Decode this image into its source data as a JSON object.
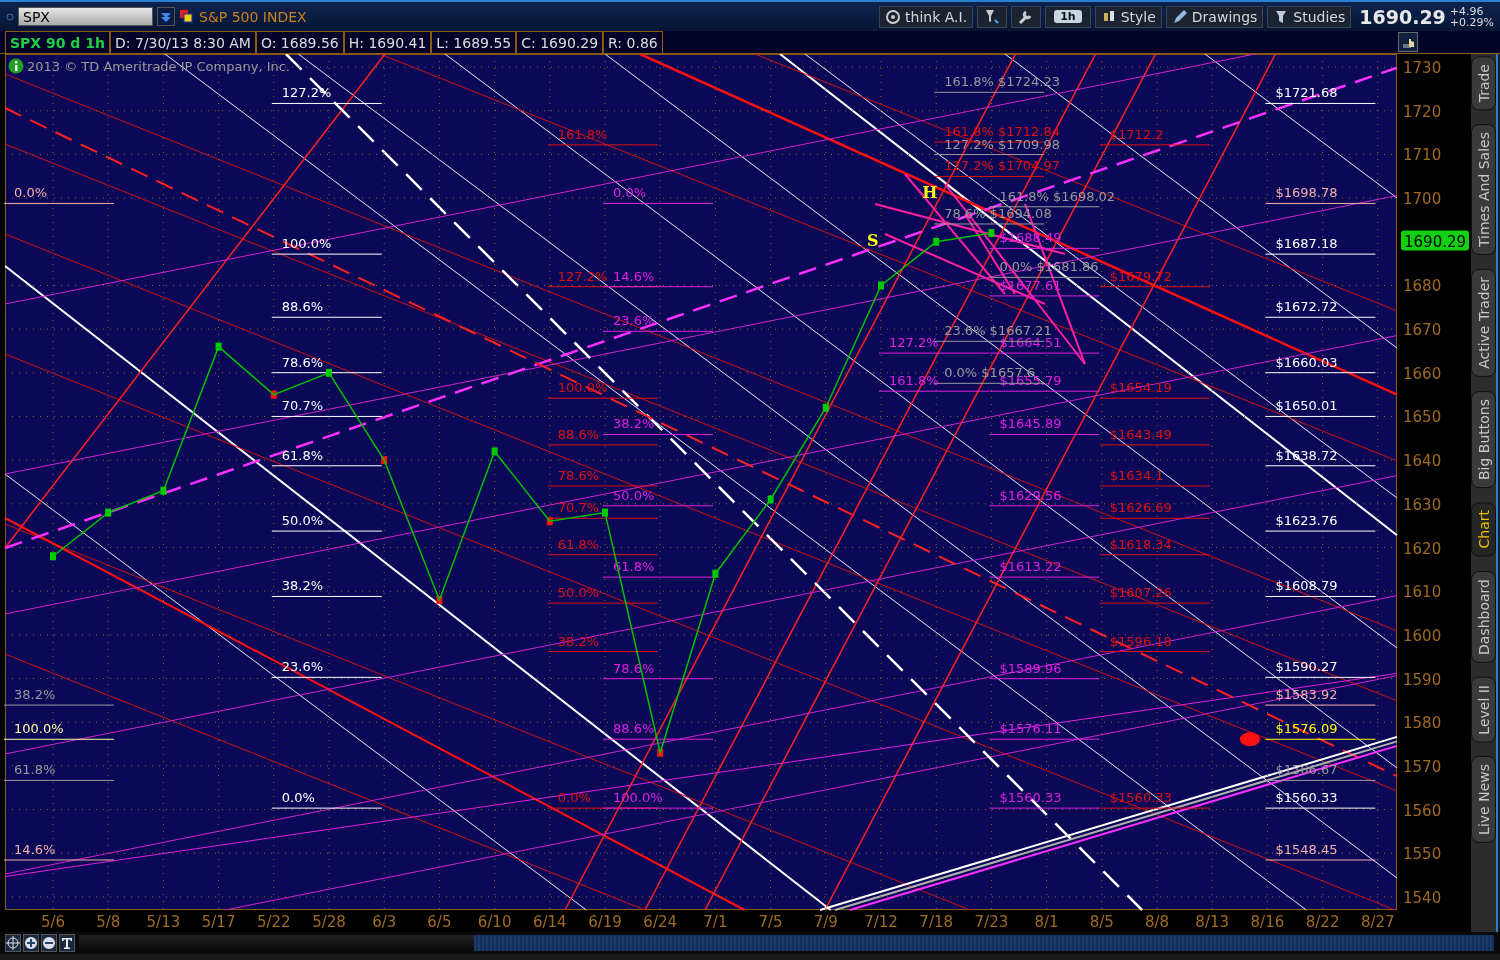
{
  "symbol_bar": {
    "symbol": "SPX",
    "description": "S&P 500 INDEX"
  },
  "toolbar": [
    {
      "kind": "ai",
      "label": "think A.I."
    },
    {
      "kind": "timeframe",
      "label": "1h"
    },
    {
      "kind": "style",
      "label": "Style"
    },
    {
      "kind": "drawings",
      "label": "Drawings"
    },
    {
      "kind": "studies",
      "label": "Studies"
    }
  ],
  "quote": {
    "last": "1690.29",
    "change": "+4.96",
    "change_pct": "+0.29%"
  },
  "info_strip": [
    "SPX 90 d 1h",
    "D: 7/30/13 8:30 AM",
    "O: 1689.56",
    "H: 1690.41",
    "L: 1689.55",
    "C: 1690.29",
    "R: 0.86"
  ],
  "copyright": "2013 © TD Ameritrade IP Company, Inc.",
  "chart": {
    "last_price_marker": "1690.29",
    "chart_data": {
      "type": "line",
      "grid": true,
      "categories": [
        "5/6",
        "5/8",
        "5/13",
        "5/17",
        "5/22",
        "5/28",
        "6/3",
        "6/5",
        "6/10",
        "6/14",
        "6/19",
        "6/24",
        "7/1",
        "7/5",
        "7/9",
        "7/12",
        "7/18",
        "7/23",
        "8/1",
        "8/5",
        "8/8",
        "8/13",
        "8/16",
        "8/22",
        "8/27"
      ],
      "series": [
        {
          "color": "#00c000",
          "marker": true,
          "values": [
            1618,
            1628,
            1633,
            1666,
            1655,
            1660,
            1640,
            1608,
            1642,
            1626,
            1628,
            1573,
            1614,
            1631,
            1652,
            1680,
            1690,
            1692,
            null,
            null,
            null,
            null,
            null,
            null,
            null
          ]
        }
      ],
      "ylim": [
        1537,
        1733
      ],
      "yticks": [
        1540,
        1550,
        1560,
        1570,
        1580,
        1590,
        1600,
        1610,
        1620,
        1630,
        1640,
        1650,
        1660,
        1670,
        1680,
        1700,
        1710,
        1720,
        1730
      ],
      "annotations": [
        "S",
        "H",
        "161.8% $1724.23",
        "$1721.68",
        "$1698.78",
        "$1687.18",
        "$1672.72",
        "$1660.03",
        "$1650.01",
        "$1638.72",
        "$1623.76",
        "$1608.79",
        "$1590.27",
        "$1583.92",
        "$1576.09",
        "$1566.67",
        "$1560.33",
        "$1548.45",
        "$1712.2",
        "$1679.72",
        "$1654.19",
        "$1643.49",
        "$1634.1",
        "$1626.69",
        "$1618.34",
        "$1607.26",
        "$1596.18",
        "$1560.33",
        "$1688.49",
        "$1677.61",
        "$1664.51",
        "$1655.79",
        "$1645.89",
        "$1629.56",
        "$1613.22",
        "$1589.96",
        "$1576.11",
        "$1560.33",
        "161.8% $1712.84",
        "127.2% $1709.98",
        "127.2% $1704.97",
        "161.8% $1698.02",
        "78.6% $1694.08",
        "0.0% $1681.86",
        "23.6% $1667.21",
        "0.0% $1657.6",
        "127.2%",
        "161.8%",
        "127.2%",
        "100.0%",
        "88.6%",
        "78.6%",
        "70.7%",
        "61.8%",
        "50.0%",
        "38.2%",
        "23.6%",
        "0.0%",
        "0.0%",
        "38.2%",
        "100.0%",
        "61.8%",
        "14.6%",
        "161.8%",
        "127.2%",
        "100.0%",
        "88.6%",
        "78.6%",
        "70.7%",
        "61.8%",
        "50.0%",
        "38.2%",
        "0.0%",
        "0.0%",
        "14.6%",
        "23.6%",
        "38.2%",
        "50.0%",
        "61.8%",
        "78.6%",
        "88.6%",
        "100.0%"
      ]
    }
  },
  "side_tabs": [
    {
      "label": "Trade",
      "selected": false
    },
    {
      "label": "Times And Sales",
      "selected": false
    },
    {
      "label": "Active Trader",
      "selected": false
    },
    {
      "label": "Big Buttons",
      "selected": false
    },
    {
      "label": "Chart",
      "selected": true
    },
    {
      "label": "Dashboard",
      "selected": false
    },
    {
      "label": "Level II",
      "selected": false
    },
    {
      "label": "Live News",
      "selected": false
    }
  ]
}
